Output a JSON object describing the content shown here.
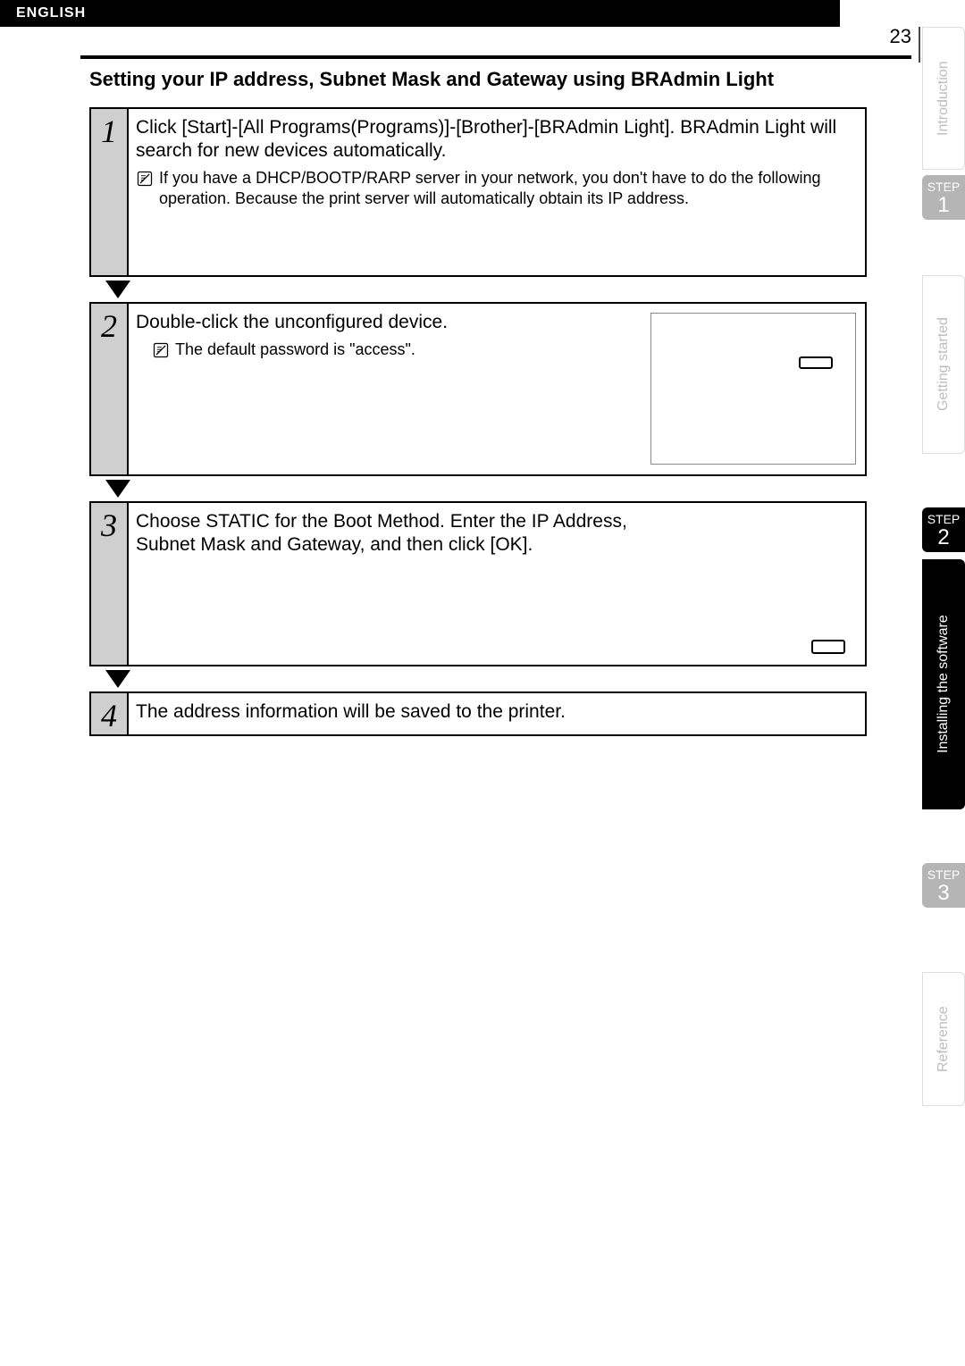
{
  "header": {
    "language": "ENGLISH",
    "page_number": "23"
  },
  "section_title": "Setting your IP address, Subnet Mask and Gateway using BRAdmin Light",
  "steps": [
    {
      "num": "1",
      "text": "Click [Start]-[All Programs(Programs)]-[Brother]-[BRAdmin Light]. BRAdmin Light will search for new devices automatically.",
      "note": "If you have a DHCP/BOOTP/RARP server in your network, you don't have to do the following operation. Because the print server will automatically obtain its IP address."
    },
    {
      "num": "2",
      "text": "Double-click the unconfigured device.",
      "note": "The default password is \"access\"."
    },
    {
      "num": "3",
      "text": "Choose STATIC for the Boot Method. Enter the IP Address, Subnet Mask and Gateway, and then click [OK]."
    },
    {
      "num": "4",
      "text": "The address information will be saved to the printer."
    }
  ],
  "side_tabs": {
    "intro": "Introduction",
    "step_label": "STEP",
    "step1_num": "1",
    "getting": "Getting started",
    "step2_num": "2",
    "install": "Installing the software",
    "step3_num": "3",
    "reference": "Reference"
  }
}
